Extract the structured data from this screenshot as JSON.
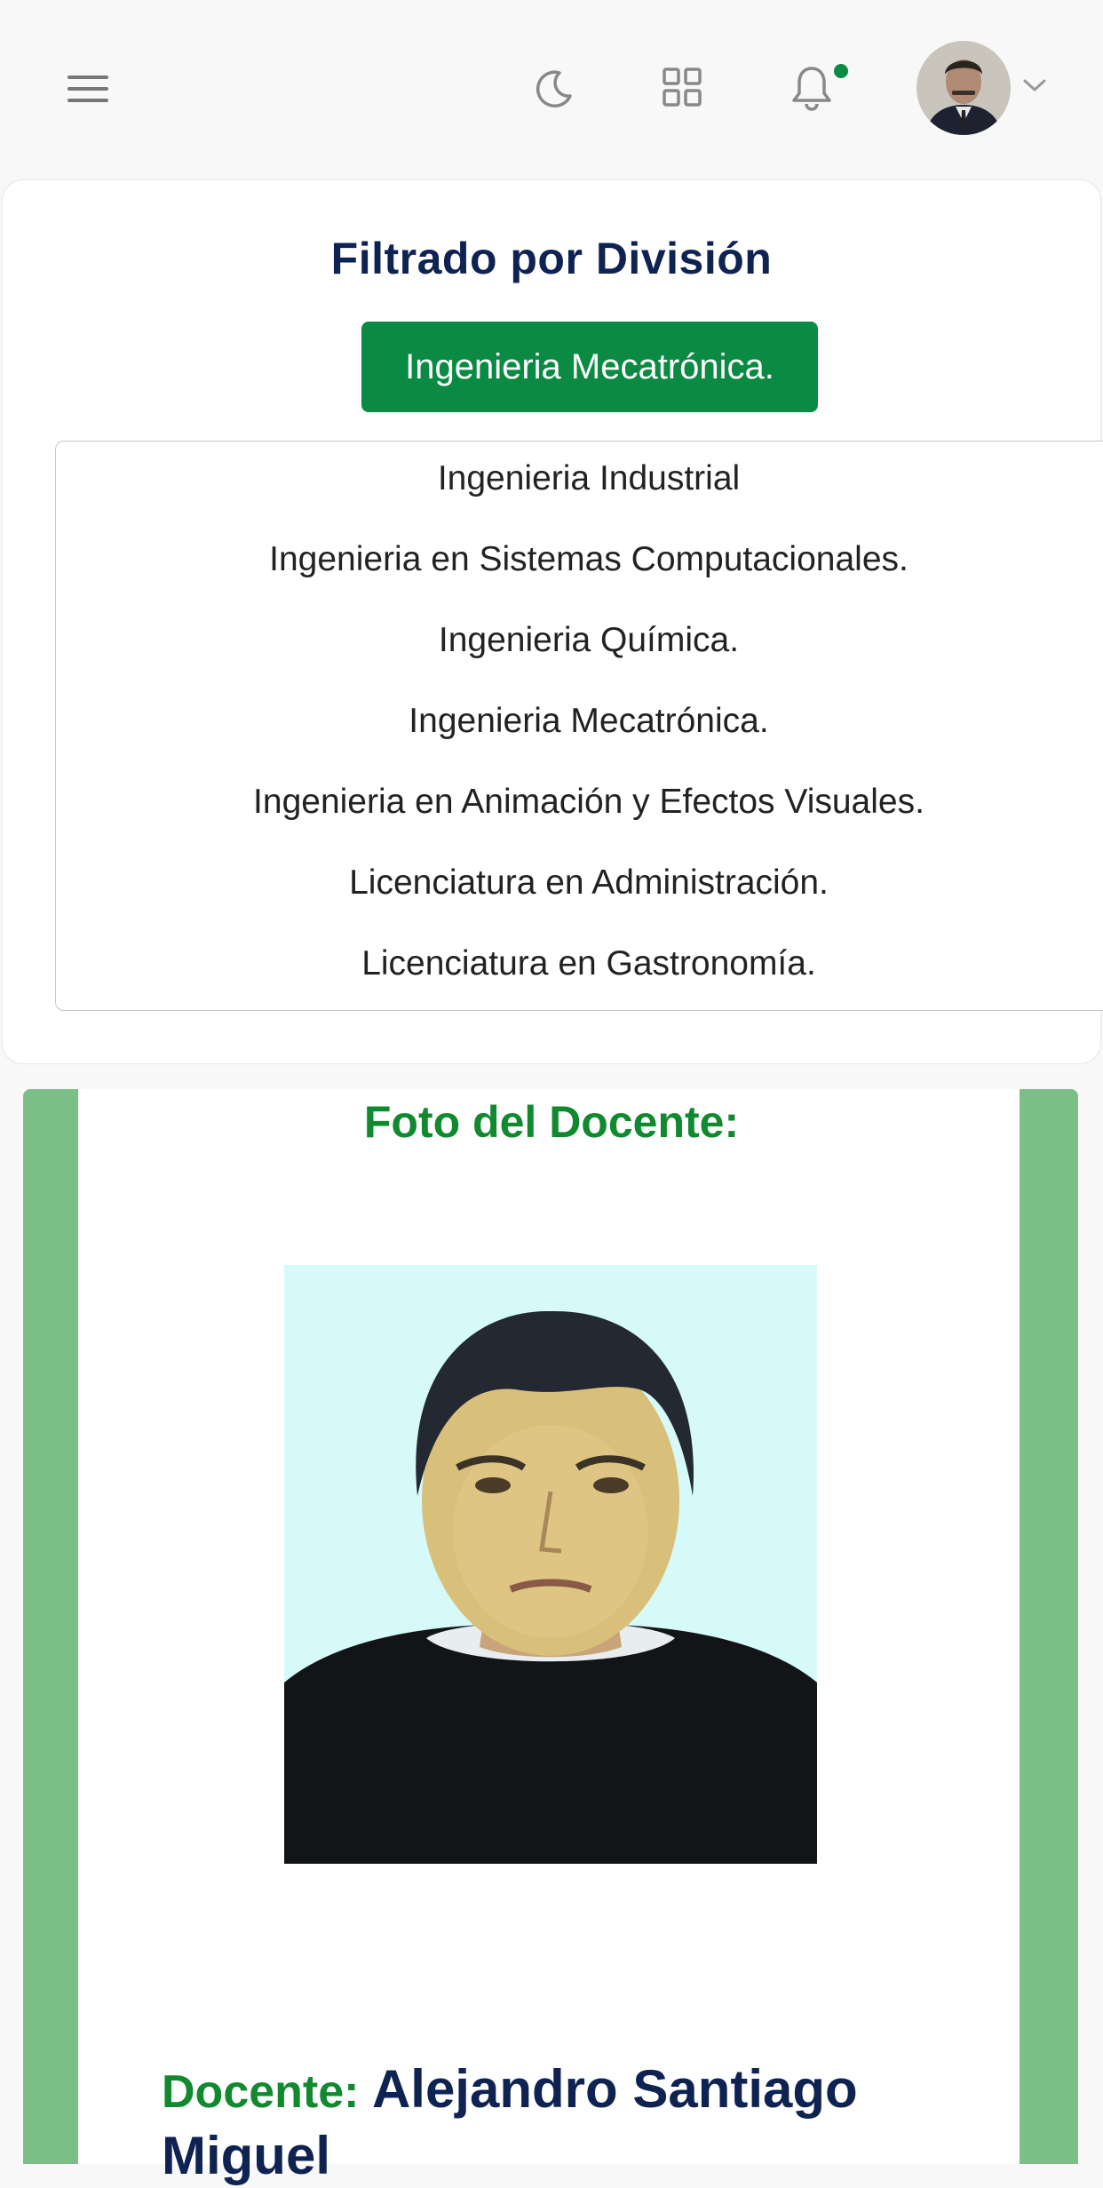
{
  "filter": {
    "title": "Filtrado por División",
    "selected": "Ingenieria Mecatrónica.",
    "options": [
      "Ingenieria Industrial",
      "Ingenieria en Sistemas Computacionales.",
      "Ingenieria Química.",
      "Ingenieria Mecatrónica.",
      "Ingenieria en Animación y Efectos Visuales.",
      "Licenciatura en Administración.",
      "Licenciatura en Gastronomía."
    ]
  },
  "teacher": {
    "photo_heading": "Foto del Docente:",
    "label": "Docente:",
    "name": "Alejandro Santiago Miguel"
  },
  "colors": {
    "brand_green": "#0a8a42",
    "heading_navy": "#0e2352",
    "stripe_green": "#7bbf87"
  },
  "icons": {
    "menu": "hamburger-menu-icon",
    "theme": "moon-icon",
    "apps": "grid-icon",
    "notifications": "bell-icon",
    "profile_dropdown": "chevron-down-icon"
  }
}
